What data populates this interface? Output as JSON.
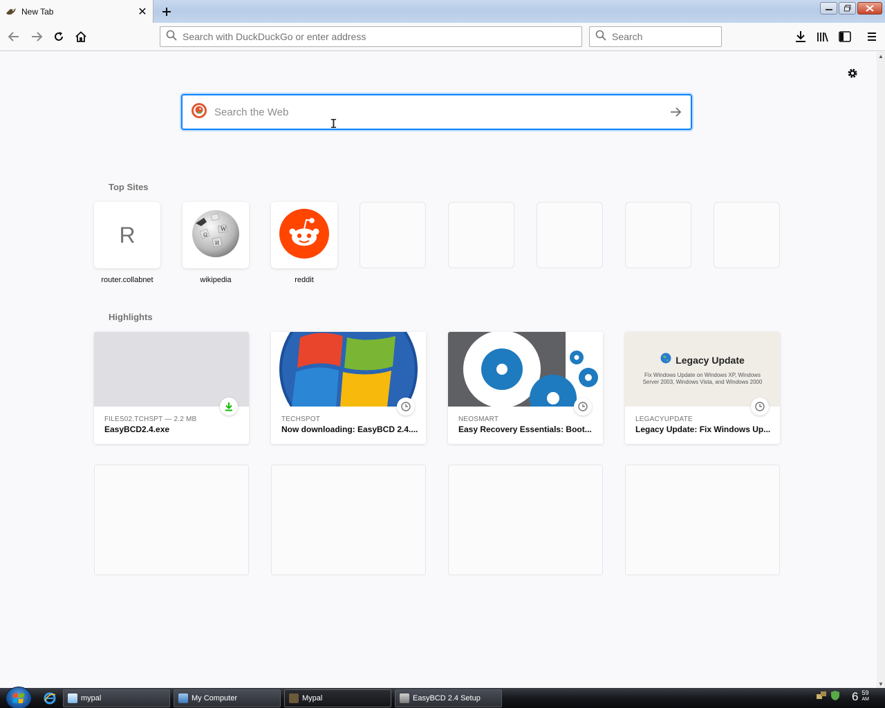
{
  "tab": {
    "title": "New Tab"
  },
  "toolbar": {
    "url_placeholder": "Search with DuckDuckGo or enter address",
    "search_placeholder": "Search"
  },
  "newtab": {
    "search_placeholder": "Search the Web",
    "topsites_title": "Top Sites",
    "highlights_title": "Highlights",
    "topsites": [
      {
        "label": "router.collabnet",
        "letter": "R",
        "icon": "letter-icon"
      },
      {
        "label": "wikipedia",
        "icon": "wikipedia-globe-icon"
      },
      {
        "label": "reddit",
        "icon": "reddit-icon"
      }
    ],
    "highlights": [
      {
        "source": "FILES02.TCHSPT — 2.2 MB",
        "title": "EasyBCD2.4.exe",
        "badge": "download-icon"
      },
      {
        "source": "TECHSPOT",
        "title": "Now downloading: EasyBCD 2.4....",
        "badge": "clock-icon"
      },
      {
        "source": "NEOSMART",
        "title": "Easy Recovery Essentials: Boot...",
        "badge": "clock-icon"
      },
      {
        "source": "LEGACYUPDATE",
        "title": "Legacy Update: Fix Windows Up...",
        "badge": "clock-icon",
        "preview_title": "Legacy Update",
        "preview_text": "Fix Windows Update on Windows XP, Windows Server 2003, Windows Vista, and Windows 2000"
      }
    ]
  },
  "taskbar": {
    "items": [
      {
        "label": "mypal"
      },
      {
        "label": "My Computer"
      },
      {
        "label": "Mypal"
      },
      {
        "label": "EasyBCD 2.4 Setup"
      }
    ],
    "clock_hour": "6",
    "clock_minute": "59",
    "clock_ampm": "AM"
  },
  "colors": {
    "accent": "#0a84ff",
    "reddit": "#ff4500",
    "download_badge": "#12bc00"
  }
}
